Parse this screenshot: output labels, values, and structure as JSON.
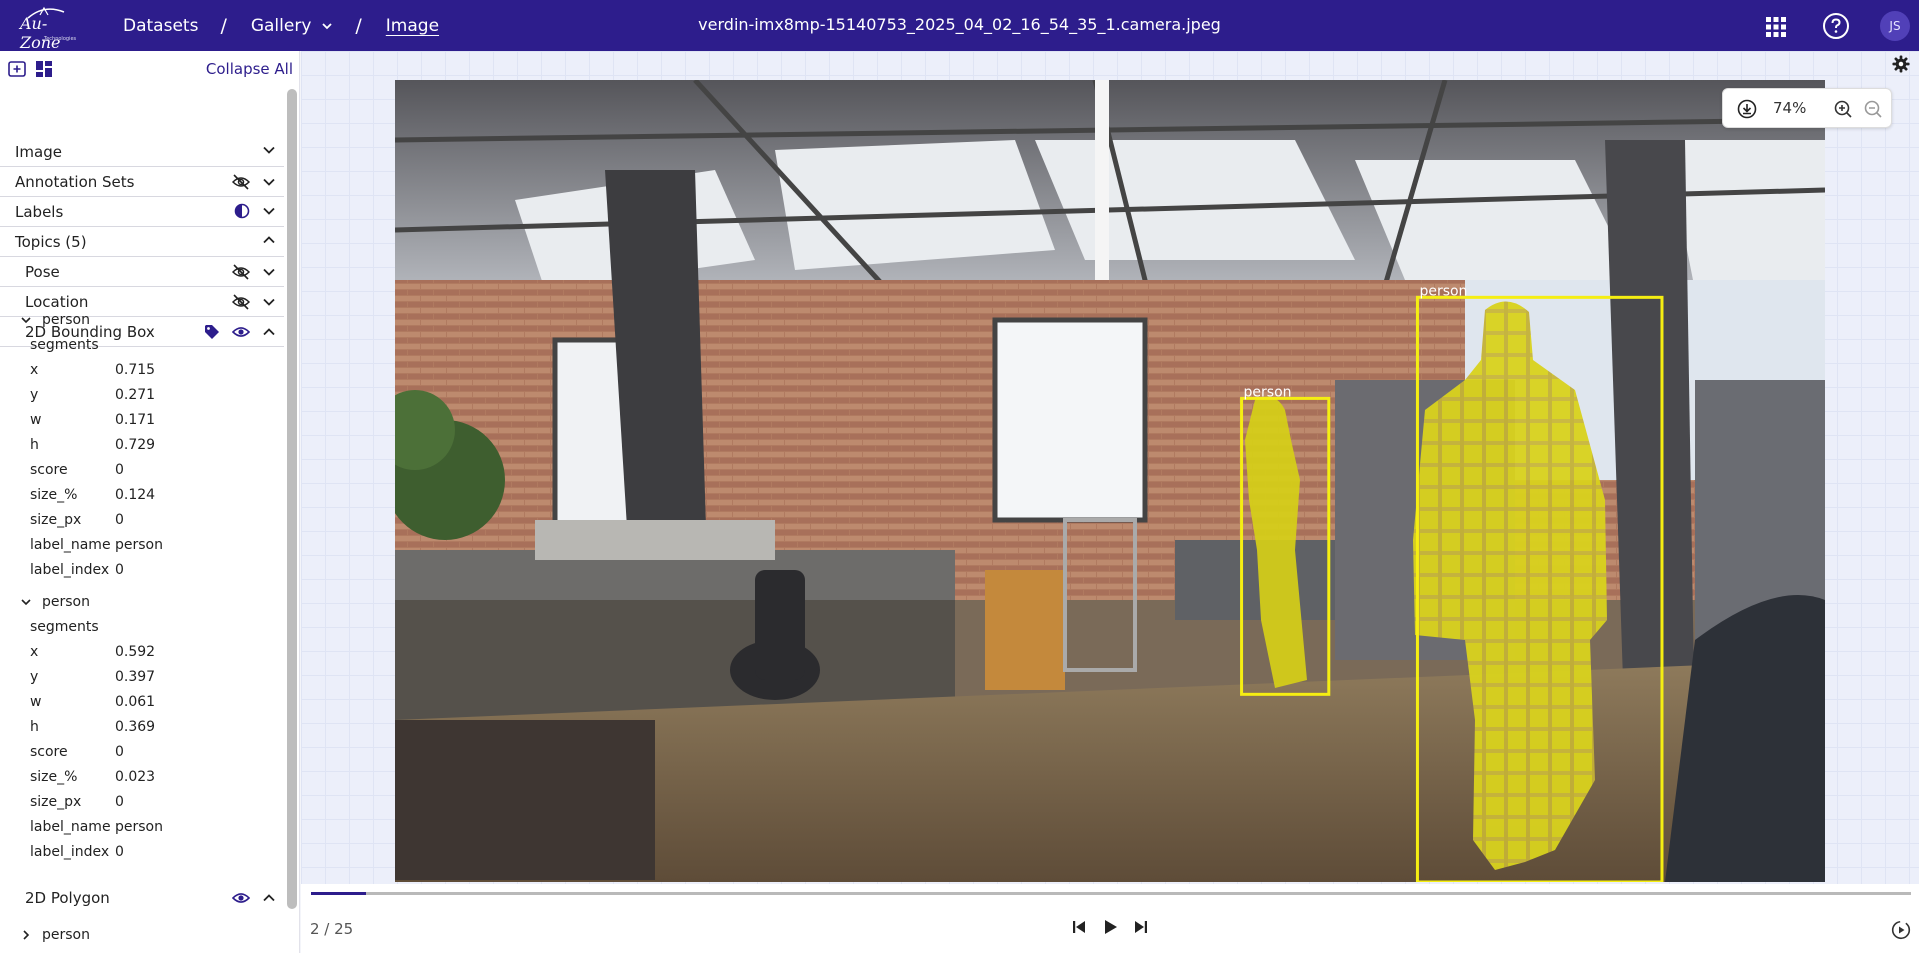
{
  "header": {
    "logo_text": "Au-Zone",
    "logo_subtext": "Technologies",
    "breadcrumbs": {
      "datasets": "Datasets",
      "gallery": "Gallery",
      "image": "Image"
    },
    "separator": "/",
    "file_title": "verdin-imx8mp-15140753_2025_04_02_16_54_35_1.camera.jpeg",
    "user_initials": "JS"
  },
  "sidebar": {
    "collapse_all": "Collapse All",
    "sections": {
      "image": "Image",
      "annotation_sets": "Annotation Sets",
      "labels": "Labels",
      "topics": "Topics (5)",
      "pose": "Pose",
      "location": "Location",
      "bbox": "2D Bounding Box",
      "polygon": "2D Polygon"
    },
    "bbox_items": [
      {
        "label": "person",
        "segments": "segments",
        "fields": [
          {
            "k": "x",
            "v": "0.715"
          },
          {
            "k": "y",
            "v": "0.271"
          },
          {
            "k": "w",
            "v": "0.171"
          },
          {
            "k": "h",
            "v": "0.729"
          },
          {
            "k": "score",
            "v": "0"
          },
          {
            "k": "size_%",
            "v": "0.124"
          },
          {
            "k": "size_px",
            "v": "0"
          },
          {
            "k": "label_name",
            "v": "person"
          },
          {
            "k": "label_index",
            "v": "0"
          }
        ]
      },
      {
        "label": "person",
        "segments": "segments",
        "fields": [
          {
            "k": "x",
            "v": "0.592"
          },
          {
            "k": "y",
            "v": "0.397"
          },
          {
            "k": "w",
            "v": "0.061"
          },
          {
            "k": "h",
            "v": "0.369"
          },
          {
            "k": "score",
            "v": "0"
          },
          {
            "k": "size_%",
            "v": "0.023"
          },
          {
            "k": "size_px",
            "v": "0"
          },
          {
            "k": "label_name",
            "v": "person"
          },
          {
            "k": "label_index",
            "v": "0"
          }
        ]
      }
    ],
    "polygon_items": [
      {
        "label": "person"
      }
    ]
  },
  "viewer": {
    "zoom": "74%",
    "overlay_label": "person",
    "box_color": "#f5ee12"
  },
  "timeline": {
    "frame_label": "2 / 25",
    "progress": 0.0345
  },
  "colors": {
    "brand": "#2d1d8c",
    "accent": "#f5ee12"
  }
}
